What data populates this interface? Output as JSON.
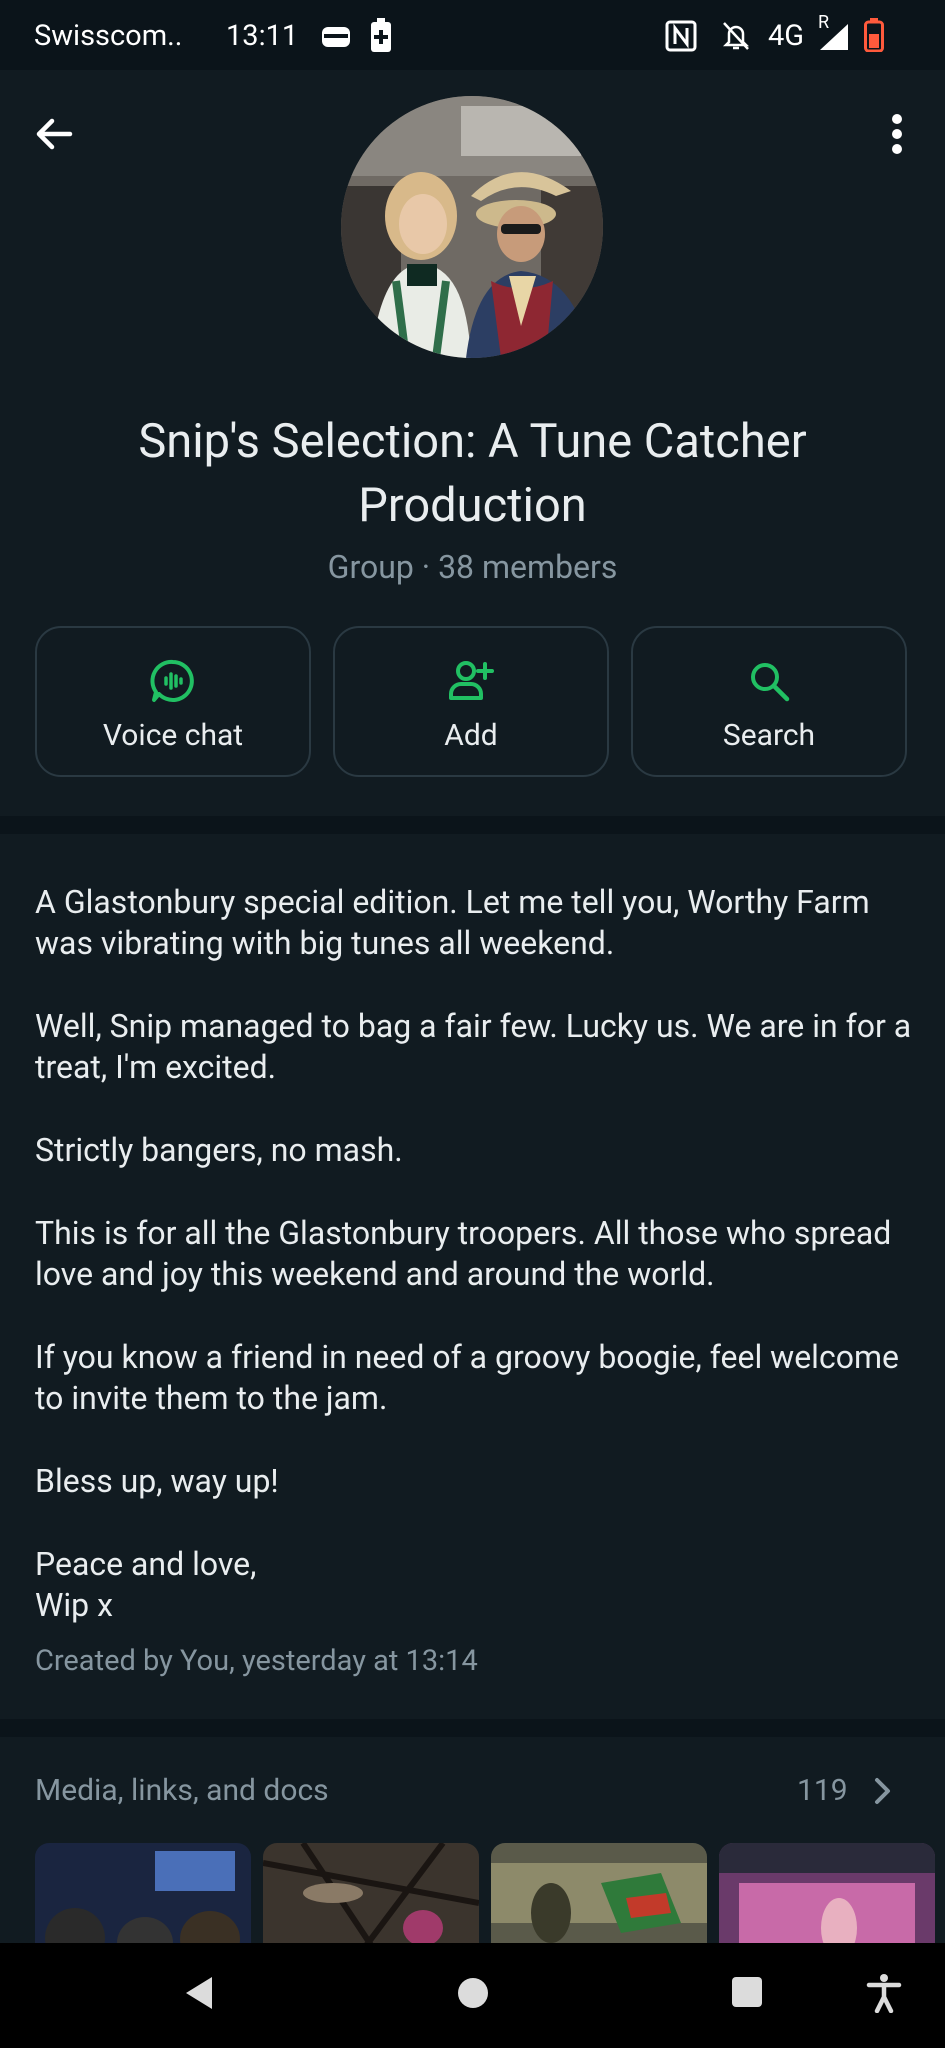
{
  "status_bar": {
    "carrier": "Swisscom..",
    "time": "13:11",
    "network": "4G",
    "roaming": "R",
    "icons": [
      "wallet-icon",
      "battery-saver-icon",
      "nfc-icon",
      "bell-off-icon",
      "signal-icon",
      "battery-icon"
    ]
  },
  "header": {
    "back_icon": "arrow-left-icon",
    "menu_icon": "more-vertical-icon",
    "title": "Snip's Selection: A Tune Catcher Production",
    "subtitle": "Group · 38 members",
    "actions": [
      {
        "label": "Voice chat",
        "icon": "voice-chat-icon"
      },
      {
        "label": "Add",
        "icon": "add-person-icon"
      },
      {
        "label": "Search",
        "icon": "search-icon"
      }
    ]
  },
  "description": {
    "paragraphs": [
      "A Glastonbury special edition. Let me tell you, Worthy Farm was vibrating with big tunes all weekend.",
      "Well, Snip managed to bag a fair few. Lucky us. We are in for a treat, I'm excited.",
      "Strictly bangers, no mash.",
      "This is for all the Glastonbury troopers.  All those who spread love and joy this weekend and around the world.",
      "If you know a friend in need of a groovy boogie, feel welcome to invite them to the jam.",
      "Bless up, way up!",
      "Peace and love,\nWip x"
    ],
    "created": "Created by You, yesterday at 13:14"
  },
  "media": {
    "title": "Media, links, and docs",
    "count": "119"
  },
  "colors": {
    "accent": "#21c063",
    "background": "#0b141a",
    "surface": "#111b21",
    "text": "#e9edef",
    "muted": "#8696a0"
  }
}
